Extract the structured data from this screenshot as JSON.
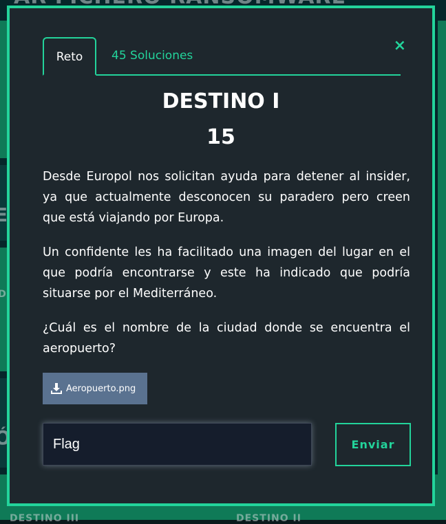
{
  "background": {
    "top_text": "AR FICHERO RANSOMWARE",
    "side_letters": [
      "E",
      "ID",
      "Ó"
    ],
    "bottom_left": "DESTINO III",
    "bottom_right": "DESTINO II"
  },
  "modal": {
    "tabs": [
      {
        "label": "Reto"
      },
      {
        "label": "45 Soluciones"
      }
    ],
    "close_label": "×",
    "title": "DESTINO I",
    "points": "15",
    "paragraphs": [
      "Desde Europol nos solicitan ayuda para detener al insider, ya que actualmente desconocen su paradero pero creen que está viajando por Europa.",
      "Un confidente les ha facilitado una imagen del lugar en el que podría encontrarse y este ha indicado que podría situarse por el Mediterráneo.",
      "¿Cuál es el nombre de la ciudad donde se encuentra el aeropuerto?"
    ],
    "file": {
      "name": "Aeropuerto.png",
      "icon": "download-icon"
    },
    "flag_input": {
      "placeholder": "Flag"
    },
    "submit_label": "Enviar"
  },
  "colors": {
    "accent": "#23d49b",
    "modal_bg": "#1e272d",
    "download_bg": "#5a7290"
  }
}
